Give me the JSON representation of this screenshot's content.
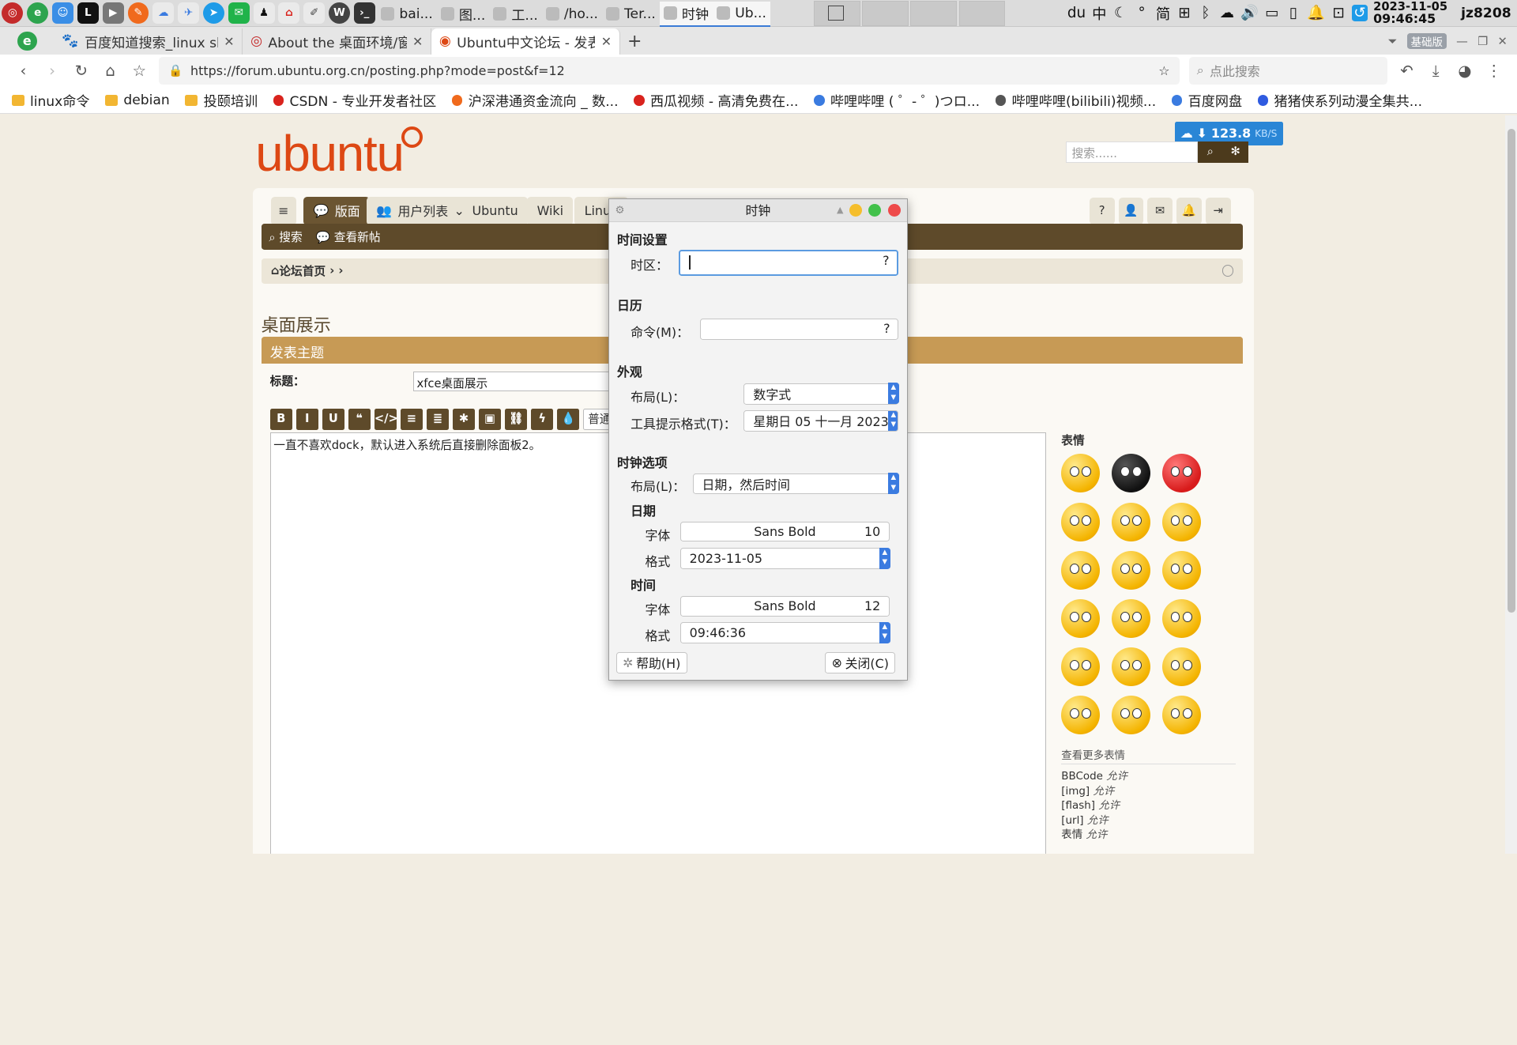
{
  "panel": {
    "tasks": [
      {
        "label": "bai...",
        "active": false
      },
      {
        "label": "图...",
        "active": false
      },
      {
        "label": "工...",
        "active": false
      },
      {
        "label": "/ho...",
        "active": false
      },
      {
        "label": "Ter...",
        "active": false
      },
      {
        "label": "时钟",
        "active": true
      },
      {
        "label": "Ub...",
        "active": true
      }
    ],
    "tray": {
      "input": "中",
      "dot": "°",
      "simp": "简"
    },
    "date": "2023-11-05",
    "time": "09:46:45",
    "user": "jz8208"
  },
  "browser": {
    "tabs": [
      {
        "title": "百度知道搜索_linux she"
      },
      {
        "title": "About the 桌面环境/窗"
      },
      {
        "title": "Ubuntu中文论坛 - 发表"
      }
    ],
    "edition": "基础版",
    "url": "https://forum.ubuntu.org.cn/posting.php?mode=post&f=12",
    "search_placeholder": "点此搜索",
    "bookmarks": [
      "linux命令",
      "debian",
      "投颐培训",
      "CSDN - 专业开发者社区",
      "沪深港通资金流向 _ 数...",
      "西瓜视频 - 高清免费在...",
      "哔哩哔哩 ( ゜- ゜)つロ...",
      "哔哩哔哩(bilibili)视频...",
      "百度网盘",
      "猪猪侠系列动漫全集共..."
    ]
  },
  "site": {
    "logo": "ubuntu",
    "search_placeholder": "搜索......",
    "speed": "123.8",
    "speed_unit": "KB/S",
    "nav": {
      "board": "版面",
      "users": "用户列表",
      "ubuntu": "Ubuntu",
      "wiki": "Wiki",
      "linux": "Linux"
    },
    "subnav": {
      "search": "搜索",
      "new_posts": "查看新帖"
    },
    "crumb": "论坛首页",
    "page_title": "桌面展示",
    "post_header": "发表主题",
    "subject_label": "标题：",
    "subject_value": "xfce桌面展示",
    "toolbar": [
      "B",
      "I",
      "U",
      "❝",
      "</>",
      "≡",
      "≣",
      "✱",
      "▣",
      "⛓",
      "ϟ",
      "💧"
    ],
    "font_size": "普通",
    "body": "一直不喜欢dock，默认进入系统后直接删除面板2。",
    "smilies_title": "表情",
    "smilies_more": "查看更多表情",
    "bbcode": [
      {
        "k": "BBCode",
        "v": "允许"
      },
      {
        "k": "[img]",
        "v": "允许"
      },
      {
        "k": "[flash]",
        "v": "允许"
      },
      {
        "k": "[url]",
        "v": "允许"
      },
      {
        "k": "表情",
        "v": "允许"
      }
    ]
  },
  "dialog": {
    "title": "时钟",
    "time_settings": "时间设置",
    "timezone_label": "时区：",
    "timezone_value": "",
    "calendar": "日历",
    "command_label": "命令(M)：",
    "command_value": "",
    "appearance": "外观",
    "layout_label": "布局(L)：",
    "layout_value": "数字式",
    "tooltip_label": "工具提示格式(T)：",
    "tooltip_value": "星期日 05 十一月 2023",
    "clock_options": "时钟选项",
    "clock_layout_label": "布局(L)：",
    "clock_layout_value": "日期，然后时间",
    "date": "日期",
    "date_font_label": "字体",
    "date_font": "Sans Bold",
    "date_font_size": "10",
    "date_format_label": "格式",
    "date_format": "2023-11-05",
    "time": "时间",
    "time_font_label": "字体",
    "time_font": "Sans Bold",
    "time_font_size": "12",
    "time_format_label": "格式",
    "time_format": "09:46:36",
    "help": "帮助(H)",
    "close": "关闭(C)"
  },
  "colors": {
    "ubuntu_orange": "#dd4814",
    "forum_brown": "#5e4a2a",
    "accent_blue": "#3b7be0"
  }
}
